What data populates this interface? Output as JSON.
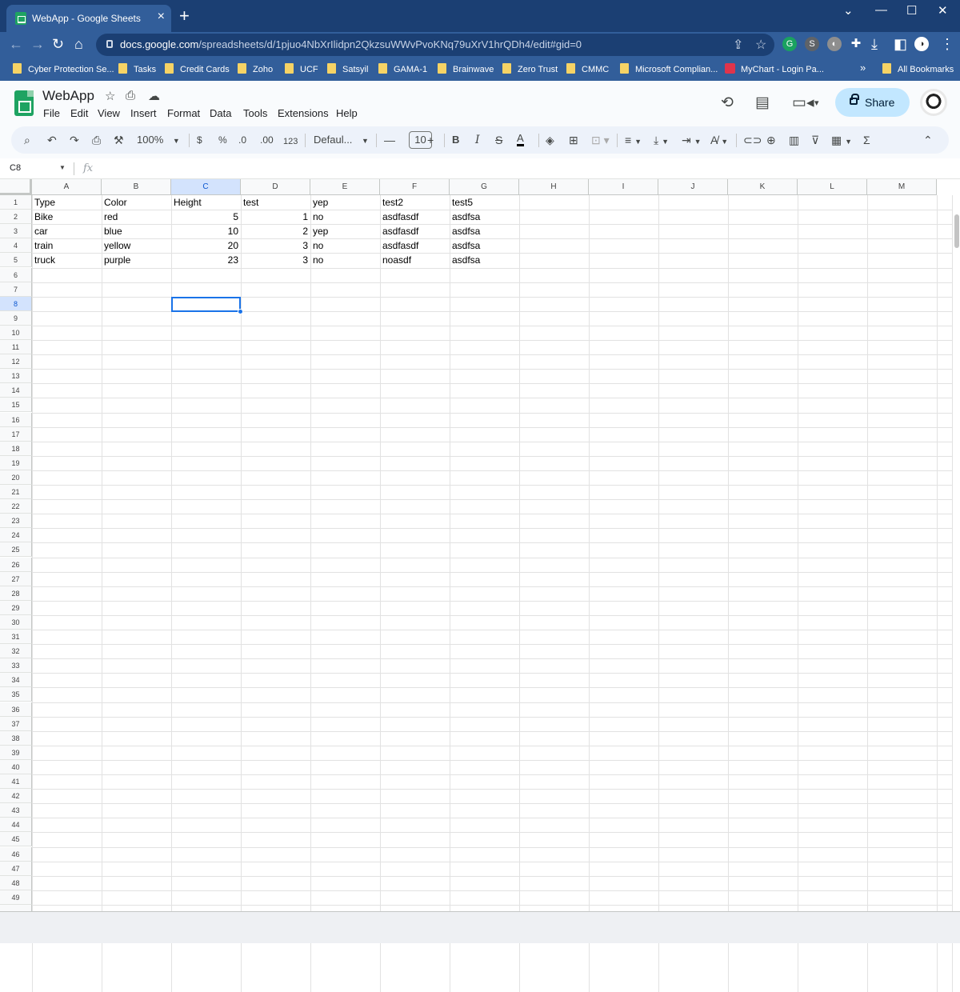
{
  "browser": {
    "tab_title": "WebApp - Google Sheets",
    "url_domain": "docs.google.com",
    "url_path": "/spreadsheets/d/1pjuo4NbXrIlidpn2QkzsuWWvPvoKNq79uXrV1hrQDh4/edit#gid=0",
    "bookmarks": [
      "Cyber Protection Se...",
      "Tasks",
      "Credit Cards",
      "Zoho",
      "UCF",
      "Satsyil",
      "GAMA-1",
      "Brainwave",
      "Zero Trust",
      "CMMC",
      "Microsoft Complian...",
      "MyChart - Login Pa..."
    ],
    "more_bookmarks": "»",
    "all_bookmarks": "All Bookmarks"
  },
  "app": {
    "doc_title": "WebApp",
    "menus": [
      "File",
      "Edit",
      "View",
      "Insert",
      "Format",
      "Data",
      "Tools",
      "Extensions",
      "Help"
    ],
    "share_label": "Share"
  },
  "toolbar": {
    "zoom": "100%",
    "currency": "$",
    "percent": "%",
    "dec_decrease": ".0",
    "dec_increase": ".00",
    "number_format": "123",
    "font": "Defaul...",
    "font_size": "10",
    "bold": "B",
    "italic": "I",
    "text_color": "A",
    "sum": "Σ"
  },
  "formula_bar": {
    "name_box": "C8",
    "fx": "fx"
  },
  "sheet": {
    "columns": [
      "A",
      "B",
      "C",
      "D",
      "E",
      "F",
      "G",
      "H",
      "I",
      "J",
      "K",
      "L",
      "M"
    ],
    "selected_column": "C",
    "selected_row": 8,
    "row_count_visible": 49,
    "rows": [
      [
        "Type",
        "Color",
        "Height",
        "test",
        "yep",
        "test2",
        "test5"
      ],
      [
        "Bike",
        "red",
        "5",
        "1",
        "no",
        "asdfasdf",
        "asdfsa"
      ],
      [
        "car",
        "blue",
        "10",
        "2",
        "yep",
        "asdfasdf",
        "asdfsa"
      ],
      [
        "train",
        "yellow",
        "20",
        "3",
        "no",
        "asdfasdf",
        "asdfsa"
      ],
      [
        "truck",
        "purple",
        "23",
        "3",
        "no",
        "noasdf",
        "asdfsa"
      ]
    ],
    "numeric_columns": [
      2,
      3
    ]
  }
}
